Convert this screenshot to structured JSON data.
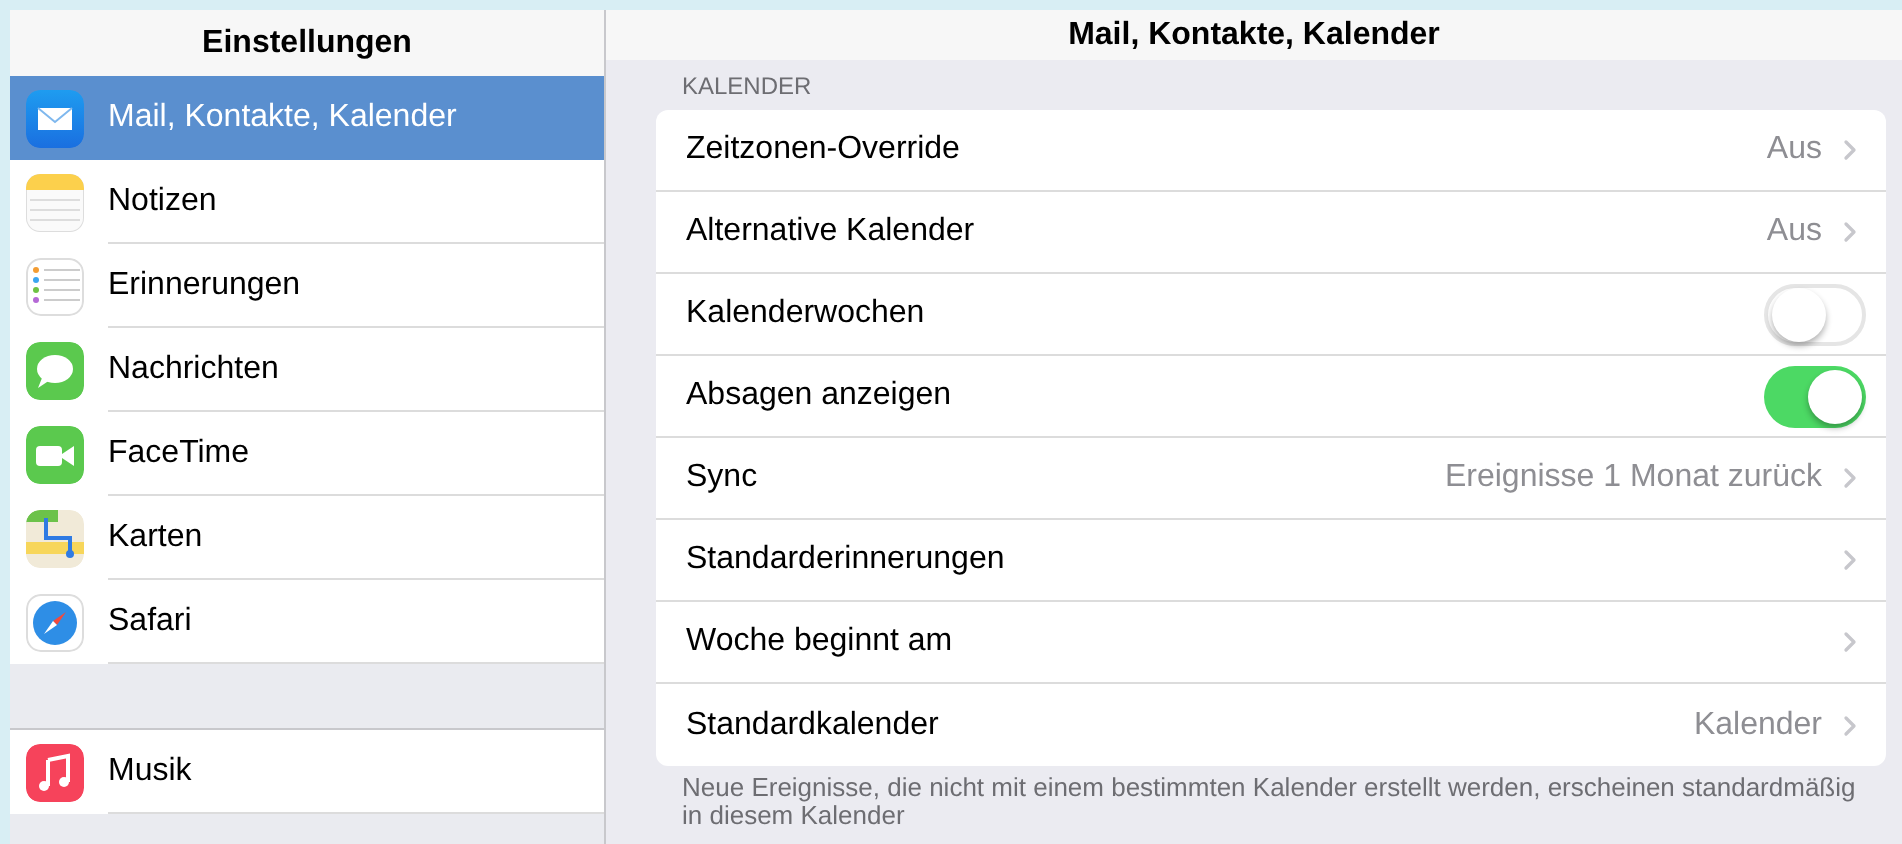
{
  "sidebar": {
    "title": "Einstellungen",
    "groups": [
      {
        "items": [
          {
            "label": "Mail, Kontakte, Kalender",
            "kind": "mail",
            "selected": true
          },
          {
            "label": "Notizen",
            "kind": "notes",
            "selected": false
          },
          {
            "label": "Erinnerungen",
            "kind": "reminders",
            "selected": false
          },
          {
            "label": "Nachrichten",
            "kind": "messages",
            "selected": false
          },
          {
            "label": "FaceTime",
            "kind": "facetime",
            "selected": false
          },
          {
            "label": "Karten",
            "kind": "maps",
            "selected": false
          },
          {
            "label": "Safari",
            "kind": "safari",
            "selected": false
          }
        ]
      },
      {
        "items": [
          {
            "label": "Musik",
            "kind": "music",
            "selected": false
          }
        ]
      }
    ]
  },
  "detail": {
    "title": "Mail, Kontakte, Kalender",
    "section": "KALENDER",
    "rows": [
      {
        "kind": "link",
        "label": "Zeitzonen-Override",
        "value": "Aus"
      },
      {
        "kind": "link",
        "label": "Alternative Kalender",
        "value": "Aus"
      },
      {
        "kind": "toggle",
        "label": "Kalenderwochen",
        "on": false
      },
      {
        "kind": "toggle",
        "label": "Absagen anzeigen",
        "on": true
      },
      {
        "kind": "link",
        "label": "Sync",
        "value": "Ereignisse 1 Monat zurück"
      },
      {
        "kind": "link",
        "label": "Standarderinnerungen"
      },
      {
        "kind": "link",
        "label": "Woche beginnt am"
      },
      {
        "kind": "link",
        "label": "Standardkalender",
        "value": "Kalender"
      }
    ],
    "footer": "Neue Ereignisse, die nicht mit einem bestimmten Kalender erstellt werden, erscheinen standardmäßig in diesem Kalender"
  }
}
